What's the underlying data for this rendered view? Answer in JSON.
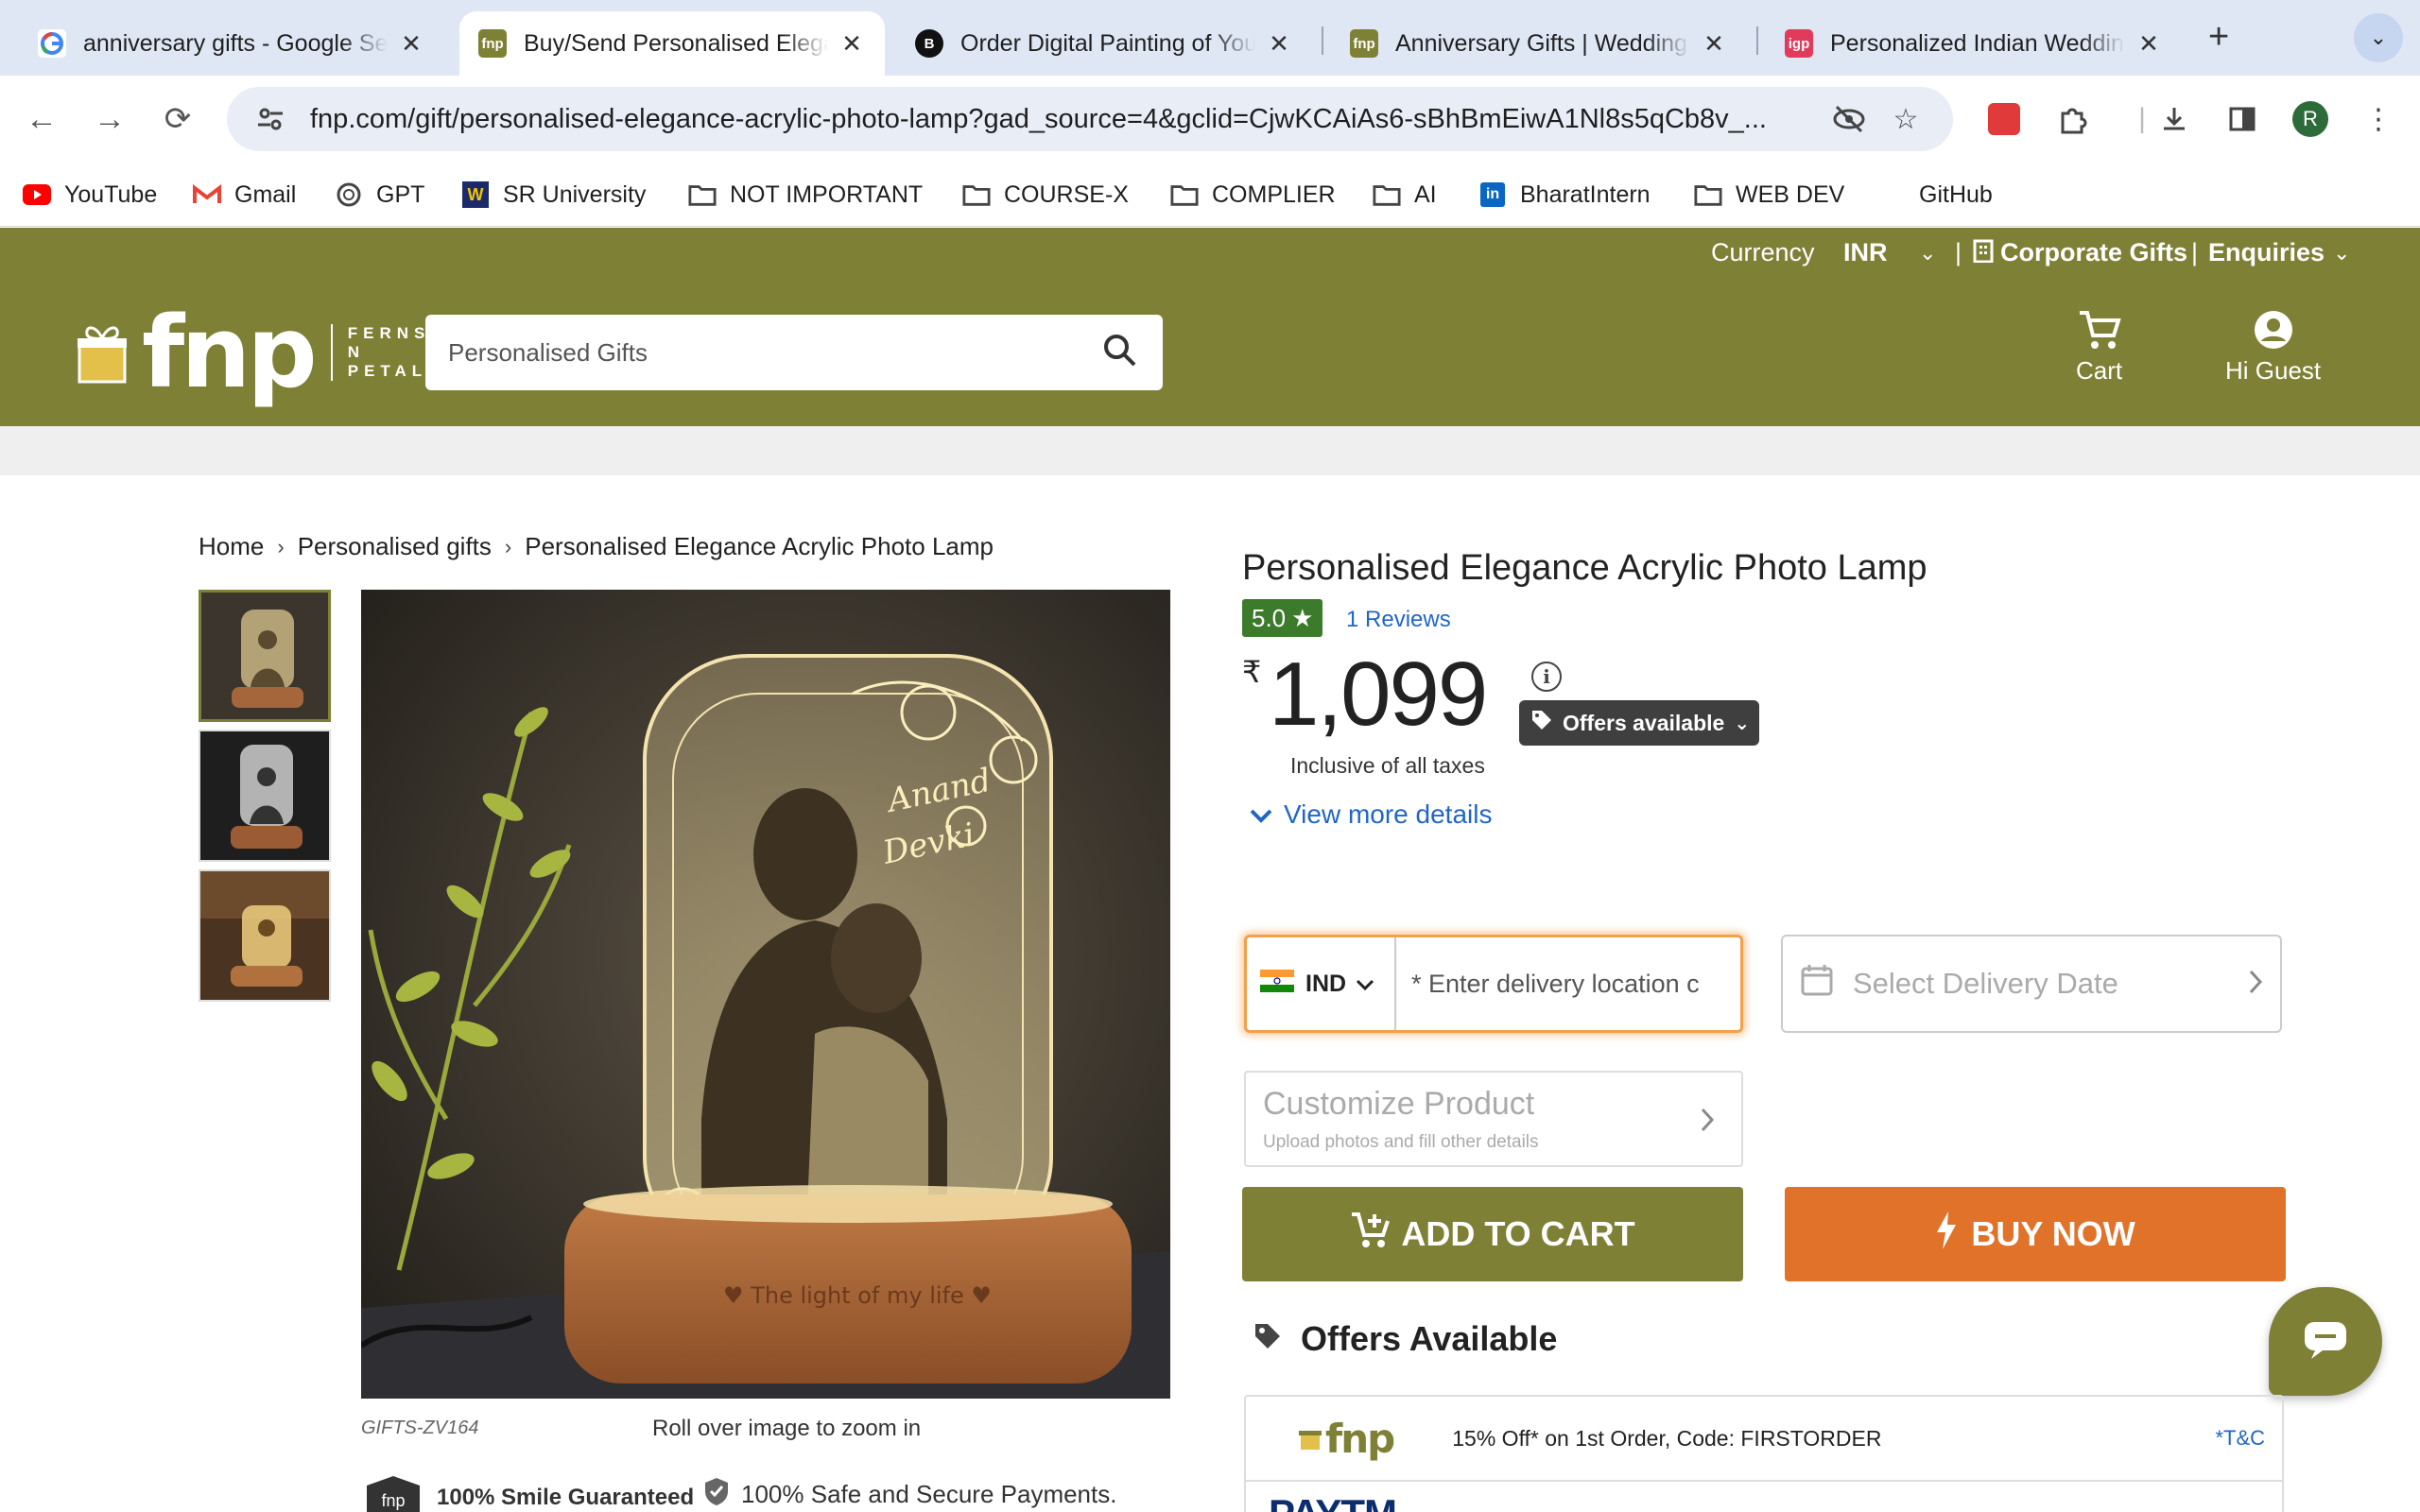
{
  "browser": {
    "tabs": [
      {
        "title": "anniversary gifts - Google Search",
        "favicon": "google-icon",
        "active": false
      },
      {
        "title": "Buy/Send Personalised Elegance Acrylic Photo Lamp",
        "favicon": "fnp-icon",
        "active": true
      },
      {
        "title": "Order Digital Painting of Your Photo",
        "favicon": "bonsai-b-icon",
        "active": false
      },
      {
        "title": "Anniversary Gifts | Wedding Anniversary",
        "favicon": "fnp-icon",
        "active": false
      },
      {
        "title": "Personalized Indian Wedding Gifts",
        "favicon": "igp-icon",
        "active": false
      }
    ],
    "url": "fnp.com/gift/personalised-elegance-acrylic-photo-lamp?gad_source=4&gclid=CjwKCAiAs6-sBhBmEiwA1Nl8s5qCb8v_...",
    "profile_initial": "R",
    "bookmarks": [
      {
        "label": "YouTube",
        "icon": "youtube-icon"
      },
      {
        "label": "Gmail",
        "icon": "gmail-icon"
      },
      {
        "label": "GPT",
        "icon": "openai-icon"
      },
      {
        "label": "SR University",
        "icon": "sr-university-icon"
      },
      {
        "label": "NOT IMPORTANT",
        "icon": "folder-icon"
      },
      {
        "label": "COURSE-X",
        "icon": "folder-icon"
      },
      {
        "label": "COMPLIER",
        "icon": "folder-icon"
      },
      {
        "label": "AI",
        "icon": "folder-icon"
      },
      {
        "label": "BharatIntern",
        "icon": "linkedin-icon"
      },
      {
        "label": "WEB DEV",
        "icon": "folder-icon"
      },
      {
        "label": "GitHub",
        "icon": ""
      }
    ]
  },
  "site": {
    "brand_color": "#7d8035",
    "currency_label": "Currency",
    "currency_value": "INR",
    "corporate_gifts": "Corporate Gifts",
    "enquiries": "Enquiries",
    "logo_word": "fnp",
    "logo_tagline": [
      "FERNS",
      "N",
      "PETALS"
    ],
    "search_placeholder": "Personalised Gifts",
    "cart_label": "Cart",
    "account_label": "Hi Guest"
  },
  "breadcrumb": [
    "Home",
    "Personalised gifts",
    "Personalised Elegance Acrylic Photo Lamp"
  ],
  "product": {
    "title": "Personalised Elegance Acrylic Photo Lamp",
    "rating": "5.0",
    "reviews": "1 Reviews",
    "currency_symbol": "₹",
    "price": "1,099",
    "offers_button": "Offers available",
    "taxes_note": "Inclusive of all taxes",
    "view_more": "View more details",
    "sku": "GIFTS-ZV164",
    "zoom_hint": "Roll over image to zoom in",
    "image_names": [
      "Anand",
      "Devki"
    ],
    "image_engraving": "♥ The light of my life ♥",
    "assurances": [
      "100% Smile Guaranteed",
      "100% Safe and Secure Payments."
    ]
  },
  "delivery": {
    "country_code": "IND",
    "location_placeholder": "* Enter delivery location c",
    "date_placeholder": "Select Delivery Date"
  },
  "customize": {
    "title": "Customize Product",
    "subtitle": "Upload photos and fill other details"
  },
  "actions": {
    "add_to_cart": "ADD TO CART",
    "buy_now": "BUY NOW"
  },
  "offers": {
    "heading": "Offers Available",
    "items": [
      {
        "provider": "fnp",
        "text": "15% Off* on 1st Order, Code: FIRSTORDER",
        "terms": "*T&C"
      }
    ],
    "partial_next_provider": "PAYTM"
  }
}
